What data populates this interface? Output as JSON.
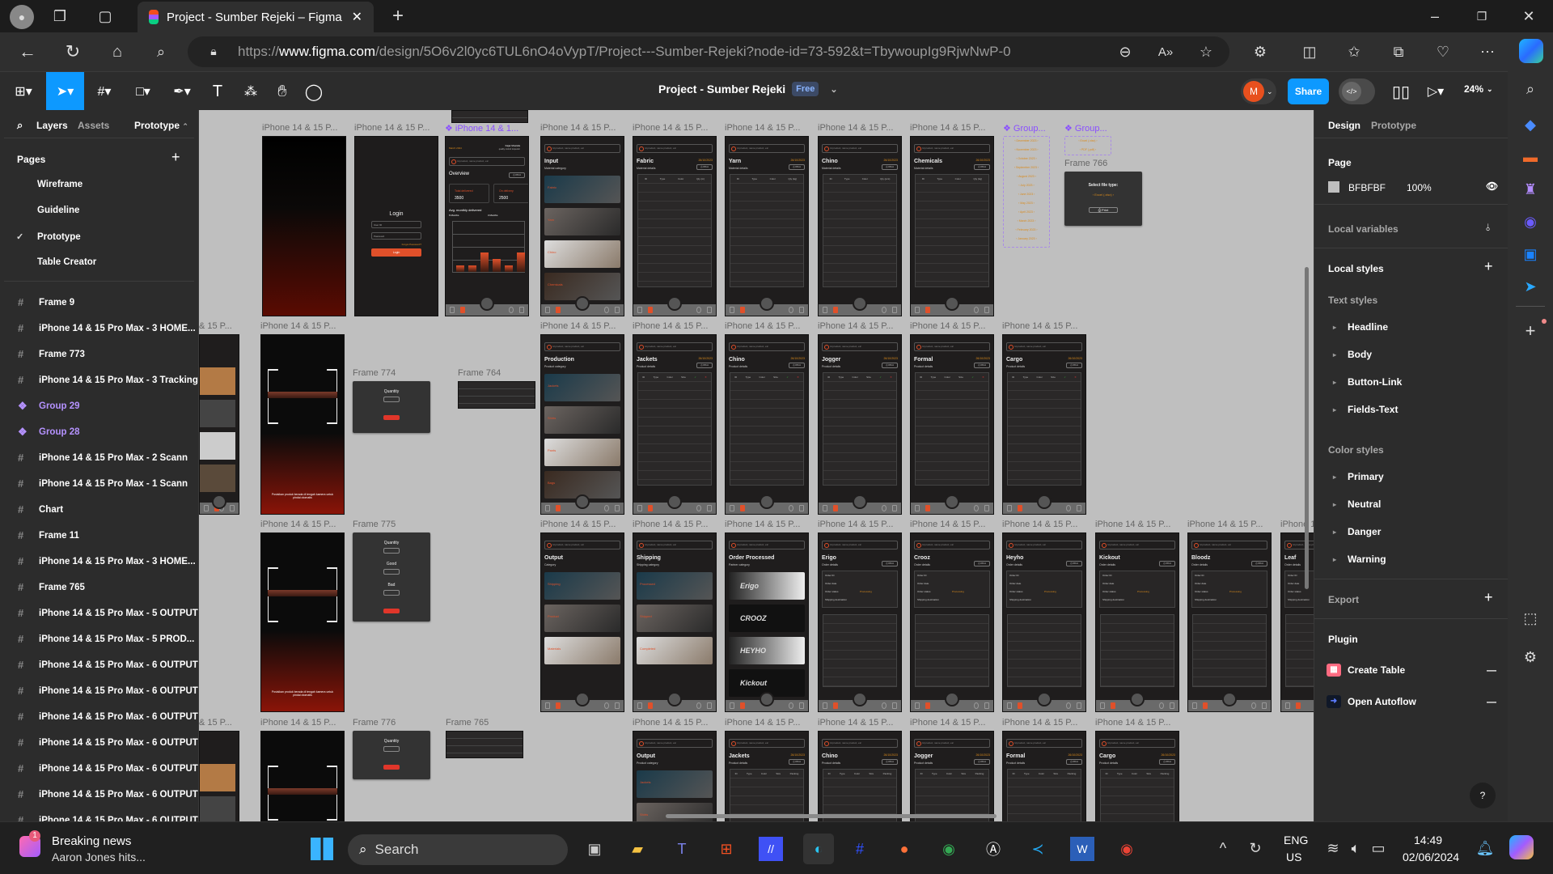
{
  "browser": {
    "tab_title": "Project - Sumber Rejeki – Figma",
    "url_scheme": "https://",
    "url_host": "www.figma.com",
    "url_path": "/design/5O6v2l0yc6TUL6nO4oVypT/Project---Sumber-Rejeki?node-id=73-592&t=TbywoupIg9RjwNwP-0"
  },
  "figma": {
    "file_title": "Project - Sumber Rejeki",
    "plan_badge": "Free",
    "avatar_initial": "M",
    "share_label": "Share",
    "zoom_level": "24%",
    "accent": "#0d99ff"
  },
  "left_panel": {
    "tabs": [
      "Layers",
      "Assets",
      "Prototype"
    ],
    "pages_heading": "Pages",
    "pages": [
      {
        "label": "Wireframe",
        "current": false
      },
      {
        "label": "Guideline",
        "current": false
      },
      {
        "label": "Prototype",
        "current": true
      },
      {
        "label": "Table Creator",
        "current": false
      }
    ],
    "layers": [
      {
        "label": "Frame 9",
        "type": "frame"
      },
      {
        "label": "iPhone 14 & 15 Pro Max - 3 HOME...",
        "type": "frame"
      },
      {
        "label": "Frame 773",
        "type": "frame"
      },
      {
        "label": "iPhone 14 & 15 Pro Max - 3 Tracking",
        "type": "frame"
      },
      {
        "label": "Group 29",
        "type": "component"
      },
      {
        "label": "Group 28",
        "type": "component"
      },
      {
        "label": "iPhone 14 & 15 Pro Max - 2 Scann",
        "type": "frame"
      },
      {
        "label": "iPhone 14 & 15 Pro Max - 1 Scann",
        "type": "frame"
      },
      {
        "label": "Chart",
        "type": "frame"
      },
      {
        "label": "Frame 11",
        "type": "frame"
      },
      {
        "label": "iPhone 14 & 15 Pro Max - 3 HOME...",
        "type": "frame"
      },
      {
        "label": "Frame 765",
        "type": "frame"
      },
      {
        "label": "iPhone 14 & 15 Pro Max - 5 OUTPUT",
        "type": "frame"
      },
      {
        "label": "iPhone 14 & 15 Pro Max - 5 PROD...",
        "type": "frame"
      },
      {
        "label": "iPhone 14 & 15 Pro Max - 6 OUTPUT",
        "type": "frame"
      },
      {
        "label": "iPhone 14 & 15 Pro Max - 6 OUTPUT",
        "type": "frame"
      },
      {
        "label": "iPhone 14 & 15 Pro Max - 6 OUTPUT",
        "type": "frame"
      },
      {
        "label": "iPhone 14 & 15 Pro Max - 6 OUTPUT",
        "type": "frame"
      },
      {
        "label": "iPhone 14 & 15 Pro Max - 6 OUTPUT",
        "type": "frame"
      },
      {
        "label": "iPhone 14 & 15 Pro Max - 6 OUTPUT",
        "type": "frame"
      },
      {
        "label": "iPhone 14 & 15 Pro Max - 6 OUTPUT",
        "type": "frame"
      }
    ]
  },
  "right_panel": {
    "tabs": [
      "Design",
      "Prototype"
    ],
    "page_heading": "Page",
    "page_color": "BFBFBF",
    "page_opacity": "100%",
    "local_variables": "Local variables",
    "local_styles": "Local styles",
    "text_styles_heading": "Text styles",
    "text_styles": [
      "Headline",
      "Body",
      "Button-Link",
      "Fields-Text"
    ],
    "color_styles_heading": "Color styles",
    "color_styles": [
      "Primary",
      "Neutral",
      "Danger",
      "Warning"
    ],
    "export": "Export",
    "plugin_heading": "Plugin",
    "plugins": [
      "Create Table",
      "Open Autoflow"
    ],
    "help": "?"
  },
  "canvas": {
    "background": "#BFBFBF",
    "frames": [
      {
        "label": "iPhone 14 & 15 P...",
        "kind": "splash"
      },
      {
        "label": "iPhone 14 & 15 P...",
        "kind": "login",
        "title": "Login",
        "fields": [
          "User ID",
          "Password"
        ],
        "link": "Forgot Password?",
        "button": "Login"
      },
      {
        "label": "iPhone 14 & 1...",
        "component": true,
        "kind": "dashboard",
        "date": "March 2024",
        "user": "Fajar Mustofa",
        "role": "quality control inspector",
        "search": "Id product, name product, etc",
        "title": "Overview",
        "button": "Print",
        "stats": [
          {
            "label": "Total delivered",
            "value": "3500"
          },
          {
            "label": "On delivery",
            "value": "2500"
          }
        ],
        "chart_title": "Avg. monthly delivered",
        "chart_tabs": [
          "6 Months",
          "3 Months"
        ],
        "chart_values": [
          1,
          1,
          3,
          2,
          1,
          3
        ]
      },
      {
        "label": "iPhone 14 & 15 P...",
        "kind": "cards",
        "title": "Input",
        "subtitle": "Material category",
        "search": "Id product, name product, etc",
        "items": [
          "Fabric",
          "Yarn",
          "Chino",
          "Chemicals"
        ]
      },
      {
        "label": "iPhone 14 & 15 P...",
        "kind": "table",
        "title": "Fabric",
        "subtitle": "Material details",
        "date": "26/10/2023",
        "button": "Print",
        "search": "Id product, name product, etc",
        "columns": [
          "ID",
          "Type",
          "Color",
          "Qty (m)"
        ]
      },
      {
        "label": "iPhone 14 & 15 P...",
        "kind": "table",
        "title": "Yarn",
        "subtitle": "Material details",
        "date": "26/10/2023",
        "button": "Print",
        "search": "Id product, name product, etc",
        "columns": [
          "ID",
          "Type",
          "Color",
          "Qty (kg)"
        ]
      },
      {
        "label": "iPhone 14 & 15 P...",
        "kind": "table",
        "title": "Chino",
        "subtitle": "Material details",
        "date": "26/10/2023",
        "button": "Print",
        "search": "Id product, name product, etc",
        "columns": [
          "ID",
          "Type",
          "Color",
          "Qty (pcs)"
        ]
      },
      {
        "label": "iPhone 14 & 15 P...",
        "kind": "table",
        "title": "Chemicals",
        "subtitle": "Material details",
        "date": "26/10/2023",
        "button": "Print",
        "search": "Id product, name product, etc",
        "columns": [
          "ID",
          "Type",
          "Color",
          "Qty (kg)"
        ]
      },
      {
        "label": "Group...",
        "component": true,
        "kind": "list",
        "items": [
          "December 2023",
          "November 2023",
          "October 2023",
          "September 2023",
          "August 2023",
          "July 2023",
          "June 2023",
          "May 2023",
          "April 2023",
          "March 2023",
          "February 2023",
          "January 2023"
        ]
      },
      {
        "label": "Group...",
        "component": true,
        "kind": "list",
        "items": [
          "Excel (.xlsx)",
          "PDF (.pdf)"
        ]
      },
      {
        "label": "Frame 766",
        "kind": "filetype",
        "title": "Select file type:",
        "value": "Excel (.xlsx)",
        "button": "Print"
      },
      {
        "label": "",
        "kind": "mini"
      },
      {
        "label": "& 15 P...",
        "kind": "partial"
      },
      {
        "label": "iPhone 14 & 15 P...",
        "kind": "scanner",
        "hint": "Posisikan produk berada di tengah kamera untuk pindai otomatis"
      },
      {
        "label": "Frame 774",
        "kind": "qty",
        "fields": [
          "Quantity"
        ],
        "button": "Save"
      },
      {
        "label": "Frame 764",
        "kind": "mini"
      },
      {
        "label": "iPhone 14 & 15 P...",
        "kind": "cards",
        "title": "Production",
        "subtitle": "Product category",
        "search": "Id product, name product, etc",
        "items": [
          "Jackets",
          "Shirts",
          "Pants",
          "Bags"
        ]
      },
      {
        "label": "iPhone 14 & 15 P...",
        "kind": "table",
        "title": "Jackets",
        "subtitle": "Product details",
        "date": "26/10/2023",
        "button": "Print",
        "search": "Id product, name product, etc",
        "columns": [
          "ID",
          "Type",
          "Color",
          "Size",
          "✓",
          "✕"
        ]
      },
      {
        "label": "iPhone 14 & 15 P...",
        "kind": "table",
        "title": "Chino",
        "subtitle": "Product details",
        "date": "26/10/2023",
        "button": "Print",
        "search": "Id product, name product, etc",
        "columns": [
          "ID",
          "Type",
          "Color",
          "Size",
          "✓",
          "✕"
        ]
      },
      {
        "label": "iPhone 14 & 15 P...",
        "kind": "table",
        "title": "Jogger",
        "subtitle": "Product details",
        "date": "26/10/2023",
        "button": "Print",
        "search": "Id product, name product, etc",
        "columns": [
          "ID",
          "Type",
          "Color",
          "Size",
          "✓",
          "✕"
        ]
      },
      {
        "label": "iPhone 14 & 15 P...",
        "kind": "table",
        "title": "Formal",
        "subtitle": "Product details",
        "date": "26/10/2023",
        "button": "Print",
        "search": "Id product, name product, etc",
        "columns": [
          "ID",
          "Type",
          "Color",
          "Size",
          "✓",
          "✕"
        ]
      },
      {
        "label": "iPhone 14 & 15 P...",
        "kind": "table",
        "title": "Cargo",
        "subtitle": "Product details",
        "date": "26/10/2023",
        "button": "Print",
        "search": "Id product, name product, etc",
        "columns": [
          "ID",
          "Type",
          "Color",
          "Size",
          "✓",
          "✕"
        ]
      },
      {
        "label": "iPhone 14 & 15 P...",
        "kind": "scanner",
        "hint": "Posisikan produk berada di tengah kamera untuk pindai otomatis"
      },
      {
        "label": "Frame 775",
        "kind": "qty",
        "fields": [
          "Quantity",
          "Good",
          "Bad"
        ],
        "button": "Save"
      },
      {
        "label": "iPhone 14 & 15 P...",
        "kind": "cards",
        "title": "Output",
        "subtitle": "Category",
        "search": "Id product, name product, etc",
        "items": [
          "Shipping",
          "Product",
          "Materials"
        ]
      },
      {
        "label": "iPhone 14 & 15 P...",
        "kind": "cards",
        "title": "Shipping",
        "subtitle": "Shipping category",
        "search": "Id product, name product, etc",
        "items": [
          "Processed",
          "Shipped",
          "Completed"
        ]
      },
      {
        "label": "iPhone 14 & 15 P...",
        "kind": "brands",
        "title": "Order Processed",
        "subtitle": "Partner category",
        "search": "Id product, name product, etc",
        "items": [
          "Erigo",
          "CROOZ",
          "HEYHO",
          "Kickout"
        ]
      },
      {
        "label": "iPhone 14 & 15 P...",
        "kind": "order",
        "title": "Erigo",
        "subtitle": "Order details",
        "button": "Print",
        "search": "Id product, name product, etc",
        "fields": [
          "Order ID",
          "Order date",
          "Order status",
          "Shipping destination"
        ],
        "status": "Processing"
      },
      {
        "label": "iPhone 14 & 15 P...",
        "kind": "order",
        "title": "Crooz",
        "subtitle": "Order details",
        "button": "Print",
        "search": "Id product, name product, etc",
        "fields": [
          "Order ID",
          "Order date",
          "Order status",
          "Shipping destination"
        ],
        "status": "Processing"
      },
      {
        "label": "iPhone 14 & 15 P...",
        "kind": "order",
        "title": "Heyho",
        "subtitle": "Order details",
        "button": "Print",
        "search": "Id product, name product, etc",
        "fields": [
          "Order ID",
          "Order date",
          "Order status",
          "Shipping destination"
        ],
        "status": "Processing"
      },
      {
        "label": "iPhone 14 & 15 P...",
        "kind": "order",
        "title": "Kickout",
        "subtitle": "Order details",
        "button": "Print",
        "search": "Id product, name product, etc",
        "fields": [
          "Order ID",
          "Order date",
          "Order status",
          "Shipping destination"
        ],
        "status": "Processing"
      },
      {
        "label": "iPhone 14 & 15 P...",
        "kind": "order",
        "title": "Bloodz",
        "subtitle": "Order details",
        "button": "Print",
        "search": "Id product, name product, etc",
        "fields": [
          "Order ID",
          "Order date",
          "Order status",
          "Shipping destination"
        ],
        "status": "Processing"
      },
      {
        "label": "iPhone 1",
        "kind": "order",
        "title": "Leaf",
        "subtitle": "Order details",
        "button": "Print",
        "search": "Id product, name product, etc",
        "fields": [
          "Order ID",
          "Order date",
          "Order status",
          "Shipping destination"
        ],
        "status": "Processing"
      },
      {
        "label": "& 15 P...",
        "kind": "partial"
      },
      {
        "label": "iPhone 14 & 15 P...",
        "kind": "scanner",
        "hint": ""
      },
      {
        "label": "Frame 776",
        "kind": "qty",
        "fields": [
          "Quantity"
        ],
        "button": "Save"
      },
      {
        "label": "Frame 765",
        "kind": "mini"
      },
      {
        "label": "iPhone 14 & 15 P...",
        "kind": "cards",
        "title": "Output",
        "subtitle": "Product category",
        "search": "Id product, name product, etc",
        "items": [
          "Jackets",
          "Shirts"
        ]
      },
      {
        "label": "iPhone 14 & 15 P...",
        "kind": "table",
        "title": "Jackets",
        "subtitle": "Product details",
        "date": "26/10/2023",
        "button": "Print",
        "search": "Id product, name product, etc",
        "columns": [
          "ID",
          "Type",
          "Color",
          "Size",
          "Packing"
        ]
      },
      {
        "label": "iPhone 14 & 15 P...",
        "kind": "table",
        "title": "Chino",
        "subtitle": "Product details",
        "date": "26/10/2023",
        "button": "Print",
        "search": "Id product, name product, etc",
        "columns": [
          "ID",
          "Type",
          "Color",
          "Size",
          "Packing"
        ]
      },
      {
        "label": "iPhone 14 & 15 P...",
        "kind": "table",
        "title": "Jogger",
        "subtitle": "Product details",
        "date": "26/10/2023",
        "button": "Print",
        "search": "Id product, name product, etc",
        "columns": [
          "ID",
          "Type",
          "Color",
          "Size",
          "Packing"
        ]
      },
      {
        "label": "iPhone 14 & 15 P...",
        "kind": "table",
        "title": "Formal",
        "subtitle": "Product details",
        "date": "26/10/2023",
        "button": "Print",
        "search": "Id product, name product, etc",
        "columns": [
          "ID",
          "Type",
          "Color",
          "Size",
          "Packing"
        ]
      },
      {
        "label": "iPhone 14 & 15 P...",
        "kind": "table",
        "title": "Cargo",
        "subtitle": "Product details",
        "date": "26/10/2023",
        "button": "Print",
        "search": "Id product, name product, etc",
        "columns": [
          "ID",
          "Type",
          "Color",
          "Size",
          "Packing"
        ]
      }
    ]
  },
  "taskbar": {
    "news_badge": "1",
    "news_title": "Breaking news",
    "news_sub": "Aaron Jones hits...",
    "search_label": "Search",
    "lang_1": "ENG",
    "lang_2": "US",
    "time": "14:49",
    "date": "02/06/2024"
  }
}
